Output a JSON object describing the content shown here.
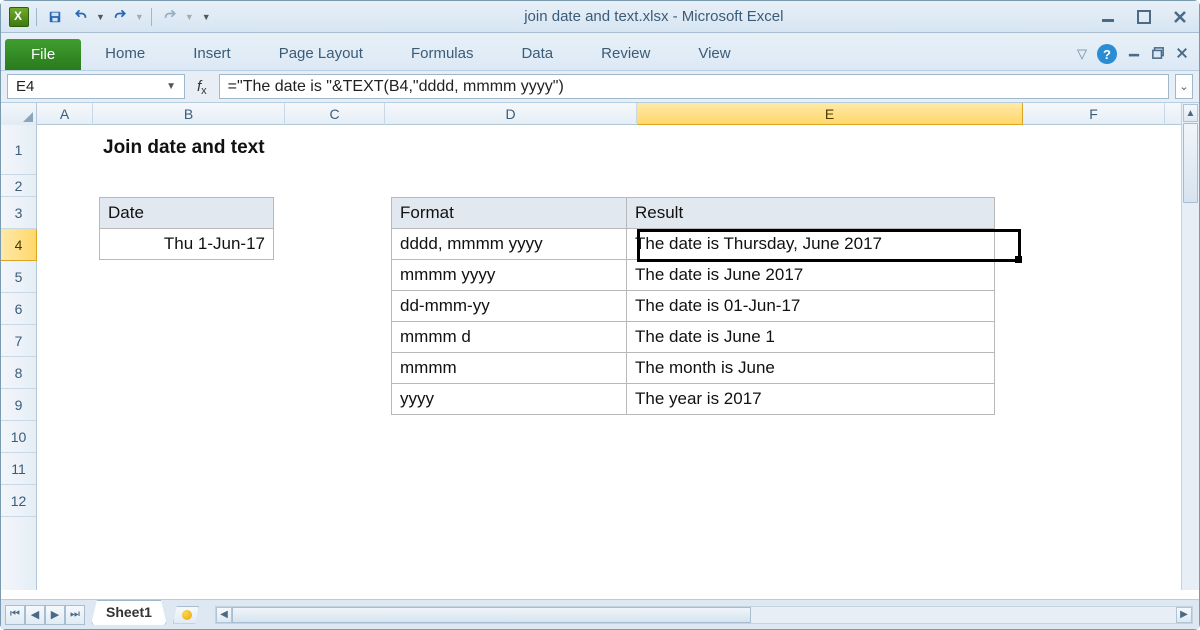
{
  "title": "join date and text.xlsx  -  Microsoft Excel",
  "ribbon": {
    "file": "File",
    "tabs": [
      "Home",
      "Insert",
      "Page Layout",
      "Formulas",
      "Data",
      "Review",
      "View"
    ]
  },
  "nameBox": "E4",
  "formula": "=\"The date is \"&TEXT(B4,\"dddd, mmmm yyyy\")",
  "columns": [
    "A",
    "B",
    "C",
    "D",
    "E",
    "F"
  ],
  "rowCount": 12,
  "selectedCol": "E",
  "selectedRow": 4,
  "sheet": {
    "title": "Join date and text",
    "dateHeader": "Date",
    "dateValue": "Thu 1-Jun-17",
    "fmtHeader": "Format",
    "resHeader": "Result",
    "rows": [
      {
        "fmt": "dddd, mmmm yyyy",
        "res": "The date is Thursday, June 2017"
      },
      {
        "fmt": "mmmm yyyy",
        "res": "The date is June 2017"
      },
      {
        "fmt": "dd-mmm-yy",
        "res": "The date is 01-Jun-17"
      },
      {
        "fmt": "mmmm d",
        "res": "The date is June 1"
      },
      {
        "fmt": "mmmm",
        "res": "The month is June"
      },
      {
        "fmt": "yyyy",
        "res": "The year is 2017"
      }
    ]
  },
  "sheetTab": "Sheet1"
}
